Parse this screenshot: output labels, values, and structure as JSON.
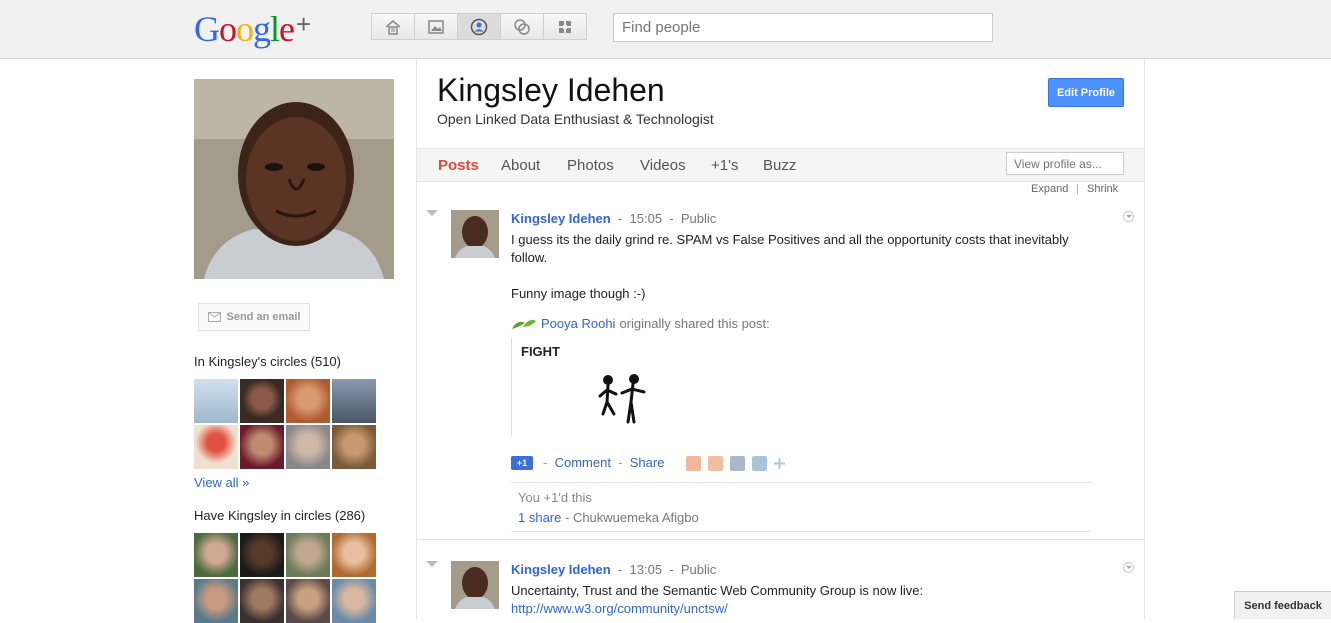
{
  "header": {
    "logo_text": "Google",
    "logo_plus": "+",
    "nav_icons": [
      {
        "name": "home-icon",
        "active": false
      },
      {
        "name": "photos-icon",
        "active": false
      },
      {
        "name": "profile-icon",
        "active": true
      },
      {
        "name": "circles-icon",
        "active": false
      },
      {
        "name": "games-icon",
        "active": false
      }
    ],
    "search_placeholder": "Find people"
  },
  "sidebar": {
    "send_email_label": "Send an email",
    "in_circles_heading": "In Kingsley's circles (510)",
    "view_all": "View all »",
    "have_in_circles_heading": "Have Kingsley in circles (286)"
  },
  "profile": {
    "name": "Kingsley Idehen",
    "tagline": "Open Linked Data Enthusiast & Technologist",
    "edit_button": "Edit Profile",
    "tabs": [
      "Posts",
      "About",
      "Photos",
      "Videos",
      "+1's",
      "Buzz"
    ],
    "active_tab": "Posts",
    "view_as_placeholder": "View profile as...",
    "expand": "Expand",
    "shrink": "Shrink"
  },
  "posts": [
    {
      "author": "Kingsley Idehen",
      "sep1": "-",
      "time": "15:05",
      "sep2": "-",
      "visibility": "Public",
      "text_line1": "I guess its the daily grind re. SPAM vs False Positives and all the opportunity costs that inevitably",
      "text_line2": "follow.",
      "text_line3": "Funny image though :-)",
      "reshared_from": "Pooya Roohi",
      "reshared_suffix": "originally shared this post:",
      "embed_title": "FIGHT",
      "plusone_label": "+1",
      "comment": "Comment",
      "share": "Share",
      "dash": "-",
      "plus_ones": "You +1'd this",
      "shares": "1 share",
      "shares_by": "- Chukwuemeka Afigbo"
    },
    {
      "author": "Kingsley Idehen",
      "sep1": "-",
      "time": "13:05",
      "sep2": "-",
      "visibility": "Public",
      "text_line1": "Uncertainty, Trust and the Semantic Web Community Group is now live:",
      "link": "http://www.w3.org/community/unctsw/"
    }
  ],
  "send_feedback": "Send feedback"
}
